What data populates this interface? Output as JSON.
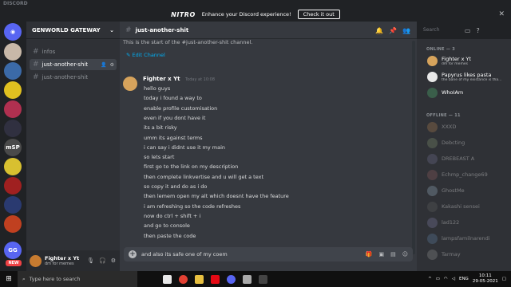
{
  "app_title": "DISCORD",
  "nitro_banner": {
    "logo": "NITRO",
    "message": "Enhance your Discord experience!",
    "button": "Check it out"
  },
  "guild_rail": {
    "badge": "NEW",
    "gg_label": "GG",
    "msp_label": "mSP"
  },
  "server": {
    "name": "GENWORLD GATEWAY",
    "channels": [
      {
        "name": "infos"
      },
      {
        "name": "just-another-shit"
      },
      {
        "name": "just-another-shit"
      }
    ]
  },
  "user_panel": {
    "name": "Fighter x Yt",
    "status": "dm for memes"
  },
  "channel_header": {
    "name": "just-another-shit",
    "search_placeholder": "Search"
  },
  "chat": {
    "intro": "This is the start of the #just-another-shit channel.",
    "edit_link": "Edit Channel",
    "author": "Fighter x Yt",
    "time": "Today at 10:08",
    "lines": [
      "hello guys",
      "today i found a way to",
      "enable profile customisation",
      "even if you dont have it",
      "its a bit risky",
      "umm its against terms",
      "i can say i didnt use it my main",
      "so lets start",
      "first go to the link on my description",
      "then complete linkvertise and u will get a text",
      "so copy it and do as i do",
      "then lemem open my alt which doesnt have the feature",
      "i am refreshing so the code refreshes",
      "now do ctrl + shift + i",
      "and go to console",
      "then paste the code"
    ],
    "composer_value": "and also its safe one of my coem"
  },
  "members": {
    "online_header": "ONLINE — 3",
    "online": [
      {
        "name": "Fighter x Yt",
        "status": "dm for memes",
        "color": "#d6a35c"
      },
      {
        "name": "Papyrus likes pasta",
        "status": "the bane of my existance is tha...",
        "color": "#e8e8e8"
      },
      {
        "name": "WhoIAm",
        "status": "",
        "color": "#3a5e4a"
      }
    ],
    "offline_header": "OFFLINE — 11",
    "offline": [
      {
        "name": "XXXD",
        "color": "#a57a4f"
      },
      {
        "name": "Debcting",
        "color": "#7a8b6c"
      },
      {
        "name": "DREBEAST A",
        "color": "#6b6b8a"
      },
      {
        "name": "Echmp_change69",
        "color": "#8a5b5b"
      },
      {
        "name": "GhostMe",
        "color": "#8fa3b5"
      },
      {
        "name": "Kakashi sensei",
        "color": "#5c5c5c"
      },
      {
        "name": "lad122",
        "color": "#77779a"
      },
      {
        "name": "lampsfamilnarendi",
        "color": "#5a7a9a"
      },
      {
        "name": "Tarmay",
        "color": "#8a8a8a"
      }
    ]
  },
  "taskbar": {
    "search_placeholder": "Type here to search",
    "lang": "ENG",
    "time": "10:11",
    "date": "29-05-2021"
  }
}
